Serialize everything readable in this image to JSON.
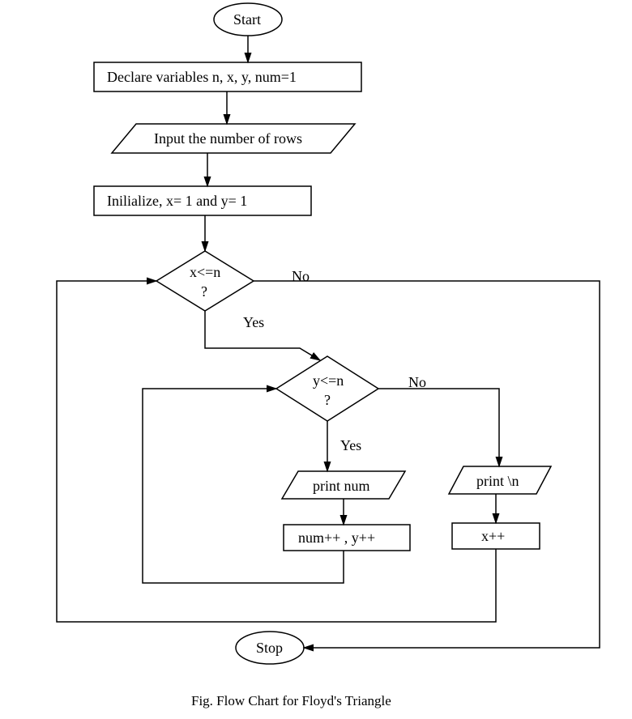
{
  "nodes": {
    "start": "Start",
    "declare": "Declare variables n, x, y, num=1",
    "input": "Input the number of rows",
    "init": "Inilialize, x= 1 and y= 1",
    "cond1": "x<=n",
    "cond2": "y<=n",
    "qmark": "?",
    "print_num": "print num",
    "increment_inner": "num++ , y++",
    "print_newline": "print \\n",
    "increment_outer": "x++",
    "stop": "Stop"
  },
  "labels": {
    "yes": "Yes",
    "no": "No"
  },
  "caption": "Fig. Flow Chart for Floyd's Triangle"
}
